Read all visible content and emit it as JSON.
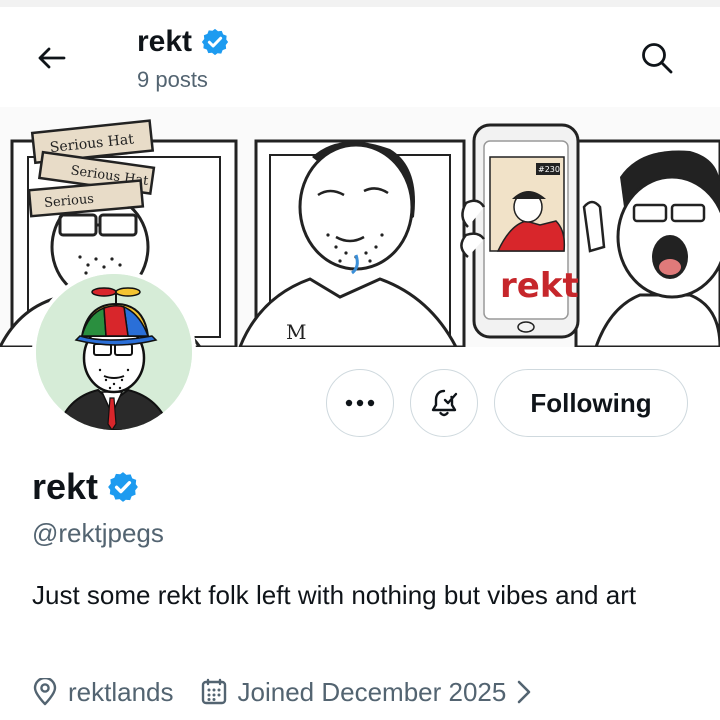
{
  "header": {
    "name": "rekt",
    "posts": "9 posts"
  },
  "banner": {
    "hat_label_1": "Serious Hat",
    "hat_label_2": "Serious Hat",
    "hat_label_3": "Serious",
    "phone_tag": "#230",
    "phone_brand": "rekt",
    "shirt_logo": "M"
  },
  "profile": {
    "name": "rekt",
    "handle": "@rektjpegs",
    "bio": "Just some rekt folk left with nothing but vibes and art",
    "location": "rektlands",
    "joined": "Joined December 2025"
  },
  "actions": {
    "follow_label": "Following"
  },
  "colors": {
    "verified": "#1d9bf0",
    "secondary_text": "#536471",
    "border": "#cfd9de",
    "avatar_bg": "#d6ecd7"
  },
  "icons": {
    "back": "arrow-left-icon",
    "search": "search-icon",
    "more": "more-dots-icon",
    "notify": "bell-check-icon",
    "location": "location-pin-icon",
    "calendar": "calendar-icon",
    "verified": "verified-badge-icon"
  }
}
